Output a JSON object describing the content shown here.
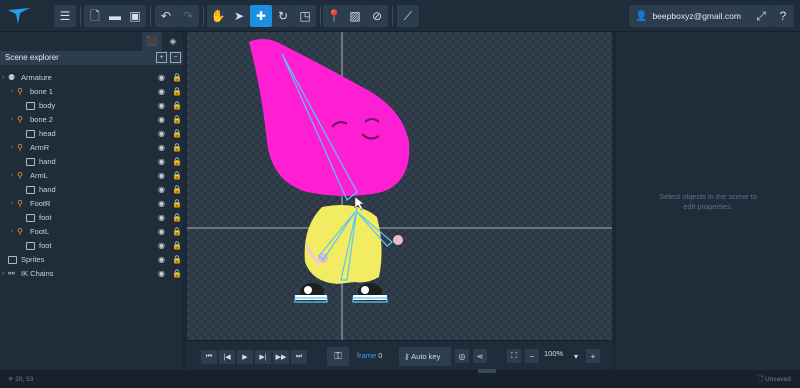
{
  "toolbar": {
    "logo": "logo-icon",
    "buttons": [
      "menu-icon",
      "new-file-icon",
      "open-folder-icon",
      "save-icon",
      "undo-icon",
      "redo-icon",
      "hand-icon",
      "select-pointer-icon",
      "move-icon",
      "rotate-icon",
      "scale-icon",
      "bone-pin-icon",
      "image-icon",
      "link-icon",
      "ik-icon",
      "fullscreen-icon",
      "help-icon"
    ],
    "user_email": "beepboxyz@gmail.com",
    "help_label": "?"
  },
  "left_panel": {
    "title": "Scene explorer",
    "tree": [
      {
        "label": "Armature",
        "type": "armature",
        "depth": 0
      },
      {
        "label": "bone 1",
        "type": "bone",
        "depth": 1
      },
      {
        "label": "body",
        "type": "image",
        "depth": 2
      },
      {
        "label": "bone 2",
        "type": "bone",
        "depth": 1
      },
      {
        "label": "head",
        "type": "image",
        "depth": 2
      },
      {
        "label": "ArmR",
        "type": "bone",
        "depth": 1
      },
      {
        "label": "hand",
        "type": "image",
        "depth": 2
      },
      {
        "label": "ArmL",
        "type": "bone",
        "depth": 1
      },
      {
        "label": "hand",
        "type": "image",
        "depth": 2
      },
      {
        "label": "FootR",
        "type": "bone",
        "depth": 1
      },
      {
        "label": "foot",
        "type": "image",
        "depth": 2
      },
      {
        "label": "FootL",
        "type": "bone",
        "depth": 1
      },
      {
        "label": "foot",
        "type": "image",
        "depth": 2
      },
      {
        "label": "Sprites",
        "type": "image",
        "depth": 0
      },
      {
        "label": "IK Chains",
        "type": "ik",
        "depth": 0
      }
    ]
  },
  "right_panel": {
    "hint_line1": "Select objects in the scene to",
    "hint_line2": "edit properties."
  },
  "timeline": {
    "frame_label": "frame",
    "frame_value": "0",
    "auto_key_label": "Auto key",
    "zoom": "100%"
  },
  "status": {
    "mouse": "20, 53",
    "state": "Unsaved"
  },
  "colors": {
    "accent": "#1d8fe0",
    "bone": "#f0a01e",
    "character_head": "#ff1fd2",
    "character_body": "#f2ec62"
  }
}
